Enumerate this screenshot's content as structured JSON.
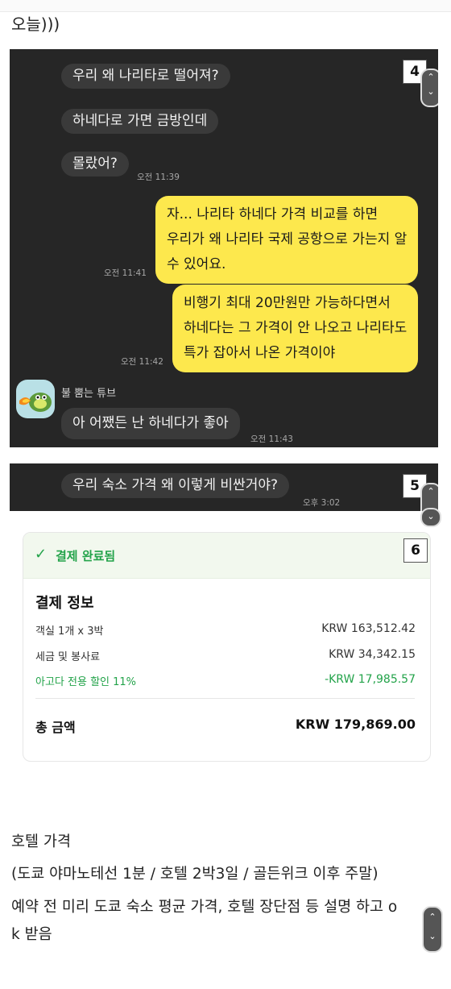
{
  "top_text": "오늘)))",
  "chat1": {
    "badge": "4",
    "messages": [
      {
        "text": "우리 왜 나리타로 떨어져?"
      },
      {
        "text": "하네다로 가면 금방인데"
      },
      {
        "text": "몰랐어?",
        "time": "오전 11:39"
      },
      {
        "lines": [
          "자... 나리타 하네다 가격 비교를 하면",
          "우리가 왜 나리타 국제 공항으로 가는지 알",
          "수 있어요."
        ],
        "time": "오전 11:41"
      },
      {
        "lines": [
          "비행기 최대 20만원만 가능하다면서",
          "하네다는 그 가격이 안 나오고 나리타도",
          "특가 잡아서 나온 가격이야"
        ],
        "time": "오전 11:42"
      },
      {
        "sender": "불 뿜는 튜브",
        "text": "아 어쨌든 난 하네다가 좋아",
        "time": "오전 11:43"
      }
    ]
  },
  "chat2": {
    "badge": "5",
    "message": "우리 숙소 가격 왜 이렇게 비싼거야?",
    "time": "오후 3:02"
  },
  "payment": {
    "badge": "6",
    "status": "결제 완료됨",
    "title": "결제 정보",
    "rows": [
      {
        "label": "객실 1개 x 3박",
        "value": "KRW 163,512.42"
      },
      {
        "label": "세금 및 봉사료",
        "value": "KRW 34,342.15"
      },
      {
        "label": "아고다 전용 할인 11%",
        "value": "-KRW 17,985.57"
      }
    ],
    "total_label": "총 금액",
    "total_value": "KRW 179,869.00",
    "accent_color": "#23a34a"
  },
  "bottom": {
    "line1": "호텔 가격",
    "line2": "(도쿄 야마노테선 1분 / 호텔 2박3일 / 골든위크 이후 주말)",
    "line3a": "예약 전 미리 도쿄 숙소 평균 가격, 호텔 장단점 등 설명 하고 o",
    "line3b": "k 받음"
  }
}
